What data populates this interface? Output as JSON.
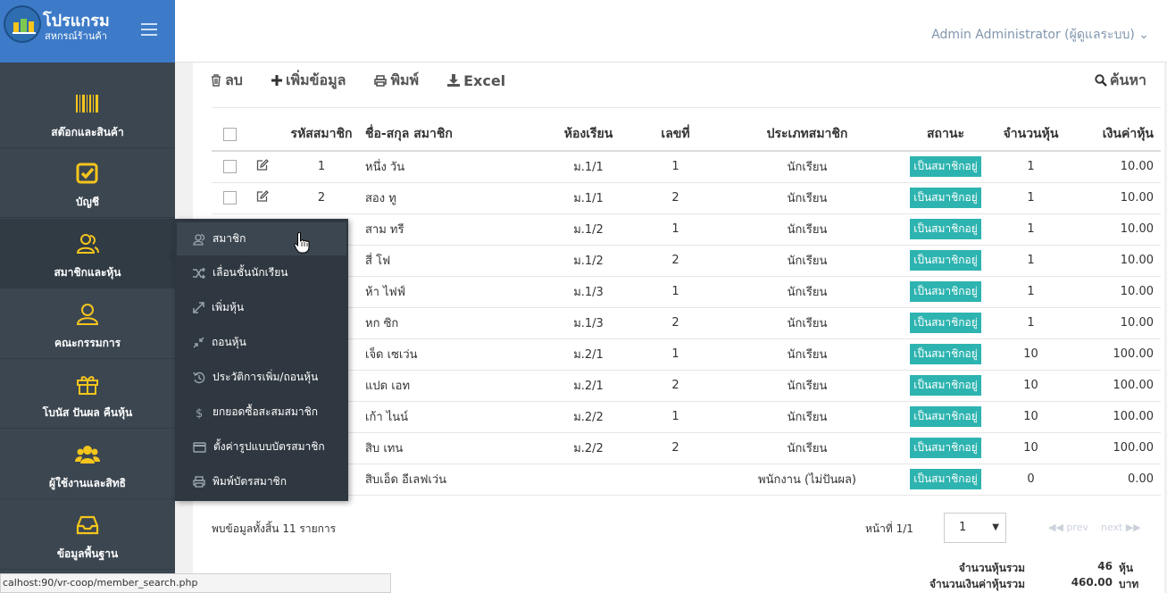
{
  "brand": {
    "title": "โปรแกรม",
    "subtitle": "สหกรณ์ร้านค้า"
  },
  "header": {
    "user": "Admin Administrator (ผู้ดูแลระบบ) ⌄"
  },
  "sidebar": {
    "items": [
      {
        "label": "สต๊อกและสินค้า",
        "icon": "barcode-icon"
      },
      {
        "label": "บัญชี",
        "icon": "check-square-icon"
      },
      {
        "label": "สมาชิกและหุ้น",
        "icon": "users-icon",
        "active": true
      },
      {
        "label": "คณะกรรมการ",
        "icon": "user-icon"
      },
      {
        "label": "โบนัส ปันผล คืนหุ้น",
        "icon": "gift-icon"
      },
      {
        "label": "ผู้ใช้งานและสิทธิ",
        "icon": "group-icon"
      },
      {
        "label": "ข้อมูลพื้นฐาน",
        "icon": "inbox-icon"
      }
    ]
  },
  "flyout": {
    "items": [
      {
        "label": "สมาชิก",
        "icon": "member-icon"
      },
      {
        "label": "เลื่อนชั้นนักเรียน",
        "icon": "shuffle-icon"
      },
      {
        "label": "เพิ่มหุ้น",
        "icon": "expand-icon"
      },
      {
        "label": "ถอนหุ้น",
        "icon": "compress-icon"
      },
      {
        "label": "ประวัติการเพิ่ม/ถอนหุ้น",
        "icon": "history-icon"
      },
      {
        "label": "ยกยอดซื้อสะสมสมาชิก",
        "icon": "dollar-icon"
      },
      {
        "label": "ตั้งค่ารูปแบบบัตรสมาชิก",
        "icon": "card-icon"
      },
      {
        "label": "พิมพ์บัตรสมาชิก",
        "icon": "print-icon"
      }
    ]
  },
  "toolbar": {
    "delete": "ลบ",
    "add": "เพิ่มข้อมูล",
    "print": "พิมพ์",
    "excel": "Excel",
    "search": "ค้นหา"
  },
  "table": {
    "headers": [
      "รหัสสมาชิก",
      "ชื่อ-สกุล สมาชิก",
      "ห้องเรียน",
      "เลขที่",
      "ประเภทสมาชิก",
      "สถานะ",
      "จำนวนหุ้น",
      "เงินค่าหุ้น"
    ],
    "rows": [
      {
        "id": "1",
        "name": "หนึ่ง วัน",
        "room": "ม.1/1",
        "no": "1",
        "type": "นักเรียน",
        "status": "เป็นสมาชิกอยู่",
        "shares": "1",
        "amount": "10.00"
      },
      {
        "id": "2",
        "name": "สอง ทู",
        "room": "ม.1/1",
        "no": "2",
        "type": "นักเรียน",
        "status": "เป็นสมาชิกอยู่",
        "shares": "1",
        "amount": "10.00"
      },
      {
        "id": "",
        "name": "สาม ทรี",
        "room": "ม.1/2",
        "no": "1",
        "type": "นักเรียน",
        "status": "เป็นสมาชิกอยู่",
        "shares": "1",
        "amount": "10.00"
      },
      {
        "id": "",
        "name": "สี่ โฟ",
        "room": "ม.1/2",
        "no": "2",
        "type": "นักเรียน",
        "status": "เป็นสมาชิกอยู่",
        "shares": "1",
        "amount": "10.00"
      },
      {
        "id": "",
        "name": "ห้า ไฟฟ์",
        "room": "ม.1/3",
        "no": "1",
        "type": "นักเรียน",
        "status": "เป็นสมาชิกอยู่",
        "shares": "1",
        "amount": "10.00"
      },
      {
        "id": "",
        "name": "หก ซิก",
        "room": "ม.1/3",
        "no": "2",
        "type": "นักเรียน",
        "status": "เป็นสมาชิกอยู่",
        "shares": "1",
        "amount": "10.00"
      },
      {
        "id": "",
        "name": "เจ็ด เซเว่น",
        "room": "ม.2/1",
        "no": "1",
        "type": "นักเรียน",
        "status": "เป็นสมาชิกอยู่",
        "shares": "10",
        "amount": "100.00"
      },
      {
        "id": "",
        "name": "แปด เอท",
        "room": "ม.2/1",
        "no": "2",
        "type": "นักเรียน",
        "status": "เป็นสมาชิกอยู่",
        "shares": "10",
        "amount": "100.00"
      },
      {
        "id": "",
        "name": "เก้า ไนน์",
        "room": "ม.2/2",
        "no": "1",
        "type": "นักเรียน",
        "status": "เป็นสมาชิกอยู่",
        "shares": "10",
        "amount": "100.00"
      },
      {
        "id": "",
        "name": "สิบ เทน",
        "room": "ม.2/2",
        "no": "2",
        "type": "นักเรียน",
        "status": "เป็นสมาชิกอยู่",
        "shares": "10",
        "amount": "100.00"
      },
      {
        "id": "",
        "name": "สิบเอ็ด อีเลฟเว่น",
        "room": "",
        "no": "",
        "type": "พนักงาน (ไม่ปันผล)",
        "status": "เป็นสมาชิกอยู่",
        "shares": "0",
        "amount": "0.00"
      }
    ]
  },
  "footer": {
    "count": "พบข้อมูลทั้งสิ้น 11 รายการ",
    "page_label": "หน้าที่ 1/1",
    "page_value": "1",
    "prev": "◀◀ prev",
    "next": "next ▶▶",
    "total_shares_label": "จำนวนหุ้นรวม",
    "total_shares": "46",
    "total_shares_unit": "หุ้น",
    "total_amount_label": "จำนวนเงินค่าหุ้นรวม",
    "total_amount": "460.00",
    "total_amount_unit": "บาท"
  },
  "statusbar": {
    "url": "calhost:90/vr-coop/member_search.php"
  },
  "colors": {
    "sidebar": "#3b4650",
    "brand": "#3d7bc8",
    "icon_yellow": "#f5c51c",
    "badge": "#2eb4b0"
  }
}
